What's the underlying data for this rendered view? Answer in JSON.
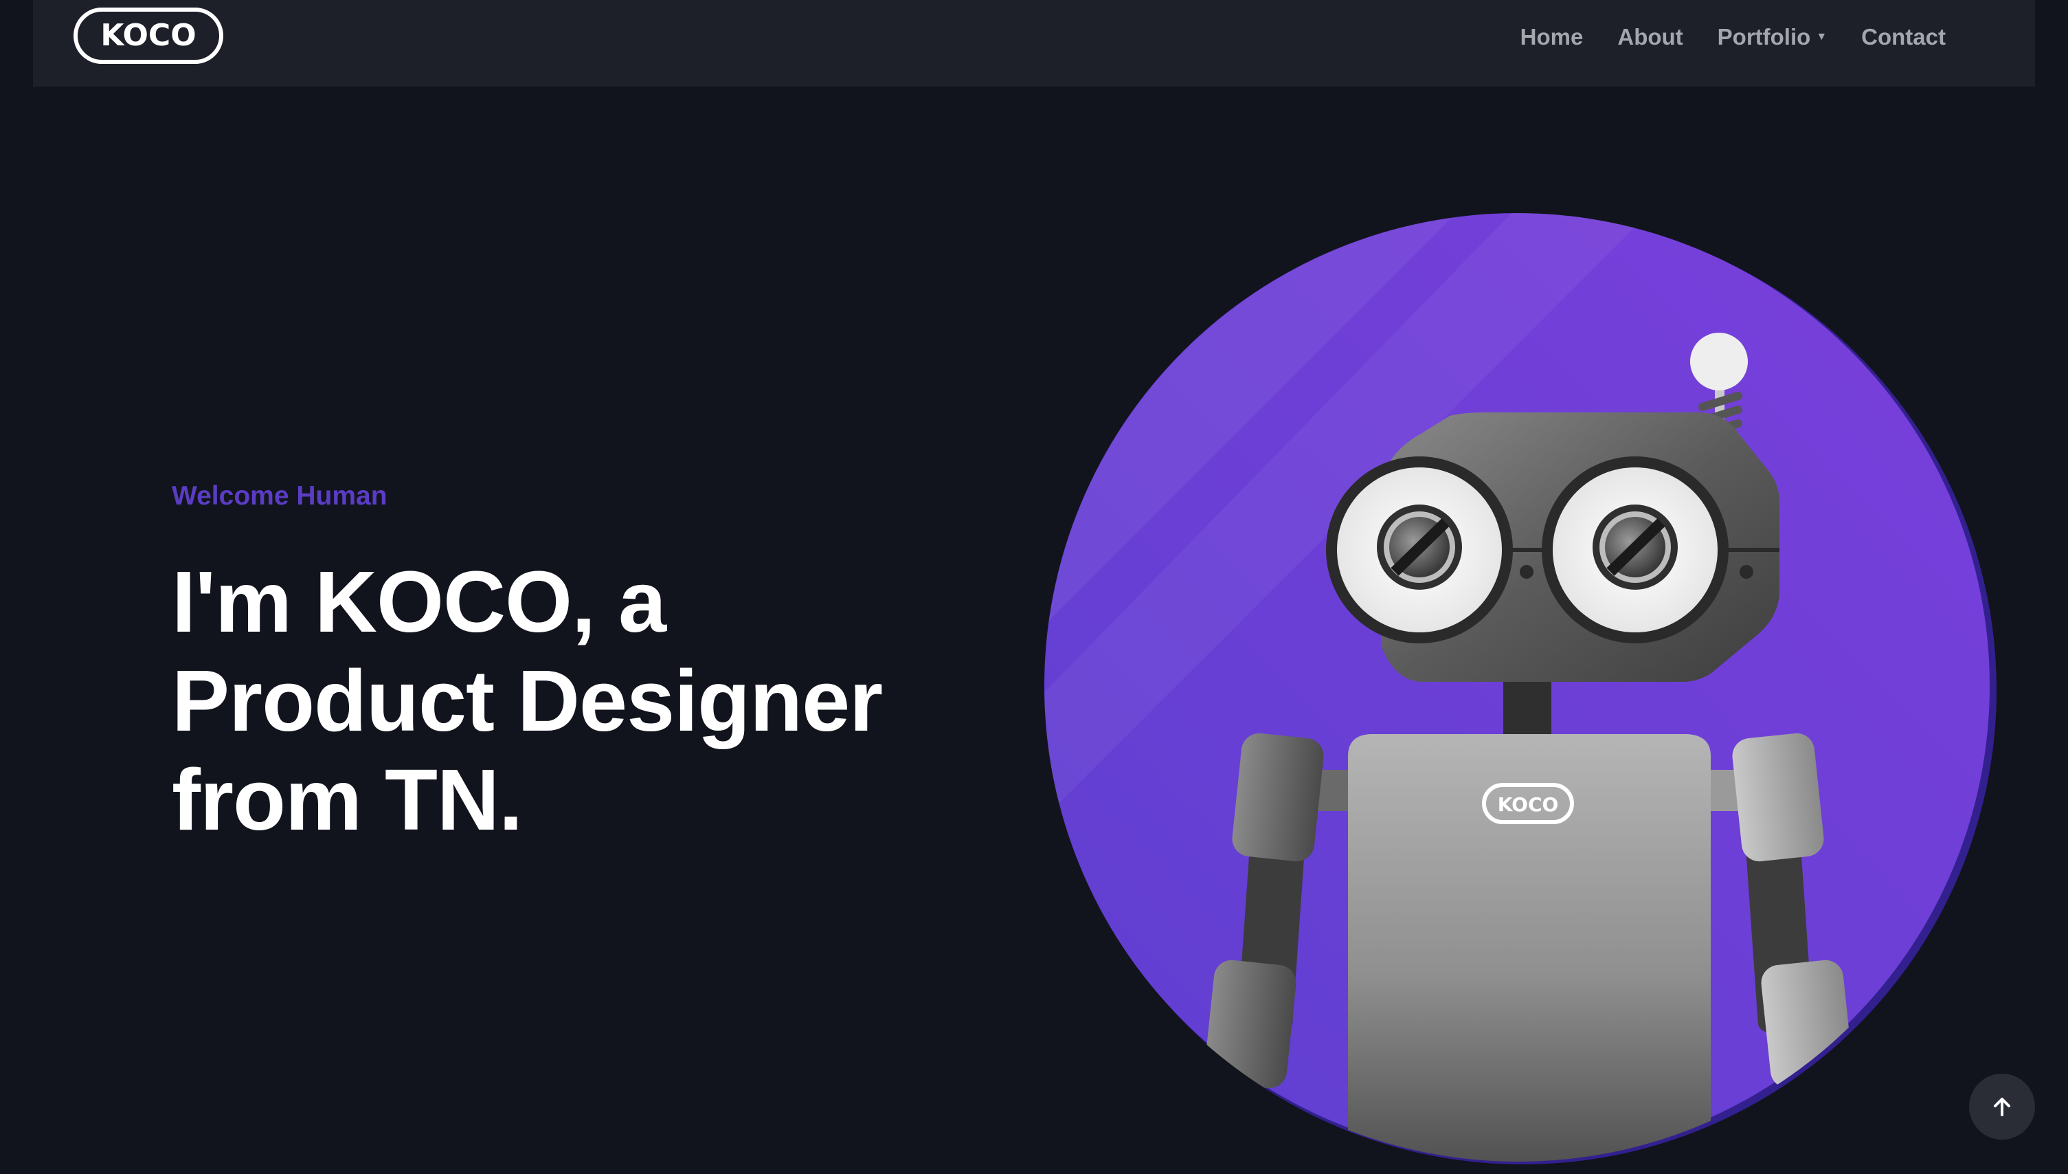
{
  "brand": {
    "logo_text": "KOCO"
  },
  "nav": {
    "items": [
      {
        "label": "Home"
      },
      {
        "label": "About"
      },
      {
        "label": "Portfolio",
        "has_dropdown": true
      },
      {
        "label": "Contact"
      }
    ]
  },
  "hero": {
    "eyebrow": "Welcome Human",
    "headline_lines": [
      "I'm KOCO, a",
      "Product Designer",
      "from TN."
    ]
  },
  "illustration": {
    "chest_logo_text": "KOCO"
  },
  "icons": {
    "scroll_top": "arrow-up-icon",
    "dropdown": "caret-down-icon"
  },
  "colors": {
    "page_bg": "#11141c",
    "nav_bg": "#1d2029",
    "accent": "#5b3cc4",
    "circle_purple": "#7040d0",
    "nav_text": "#a3a6ad"
  }
}
